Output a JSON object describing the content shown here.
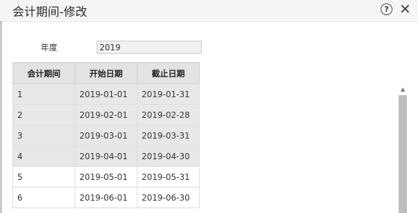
{
  "window": {
    "title": "会计期间-修改"
  },
  "icons": {
    "help": "help-circle-icon",
    "close": "close-icon"
  },
  "form": {
    "year_label": "年度",
    "year_value": "2019"
  },
  "table": {
    "headers": [
      "会计期间",
      "开始日期",
      "截止日期"
    ],
    "rows": [
      [
        "1",
        "2019-01-01",
        "2019-01-31"
      ],
      [
        "2",
        "2019-02-01",
        "2019-02-28"
      ],
      [
        "3",
        "2019-03-01",
        "2019-03-31"
      ],
      [
        "4",
        "2019-04-01",
        "2019-04-30"
      ],
      [
        "5",
        "2019-05-01",
        "2019-05-31"
      ],
      [
        "6",
        "2019-06-01",
        "2019-06-30"
      ]
    ]
  },
  "colors": {
    "locked_row_bg": "#e8e8e8",
    "header_bg": "#e3e3e3",
    "scrollbar_thumb": "#bdbdbd"
  }
}
